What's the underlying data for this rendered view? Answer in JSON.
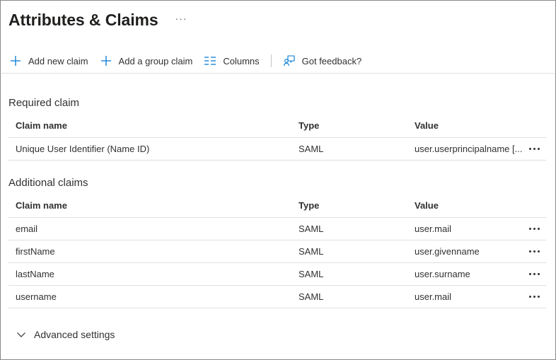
{
  "page": {
    "title": "Attributes & Claims",
    "more_label": "···"
  },
  "toolbar": {
    "items": [
      {
        "label": "Add new claim",
        "icon": "plus-icon"
      },
      {
        "label": "Add a group claim",
        "icon": "plus-icon"
      },
      {
        "label": "Columns",
        "icon": "columns-icon"
      },
      {
        "label": "Got feedback?",
        "icon": "feedback-icon"
      }
    ]
  },
  "columns": {
    "name": "Claim name",
    "type": "Type",
    "value": "Value"
  },
  "required": {
    "title": "Required claim",
    "rows": [
      {
        "name": "Unique User Identifier (Name ID)",
        "type": "SAML",
        "value": "user.userprincipalname [..."
      }
    ]
  },
  "additional": {
    "title": "Additional claims",
    "rows": [
      {
        "name": "email",
        "type": "SAML",
        "value": "user.mail"
      },
      {
        "name": "firstName",
        "type": "SAML",
        "value": "user.givenname"
      },
      {
        "name": "lastName",
        "type": "SAML",
        "value": "user.surname"
      },
      {
        "name": "username",
        "type": "SAML",
        "value": "user.mail"
      }
    ]
  },
  "advanced": {
    "label": "Advanced settings",
    "icon": "chevron-down-icon"
  },
  "colors": {
    "accent": "#0078d4",
    "text": "#323130",
    "border": "#e1dfdd"
  }
}
